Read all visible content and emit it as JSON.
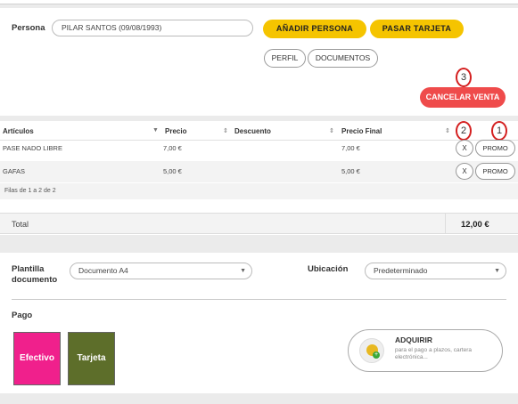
{
  "persona": {
    "label": "Persona",
    "value": "PILAR SANTOS (09/08/1993)",
    "add_button": "AÑADIR PERSONA",
    "card_button": "PASAR TARJETA",
    "profile_button": "PERFIL",
    "documents_button": "DOCUMENTOS"
  },
  "cancel_button": "CANCELAR VENTA",
  "markers": [
    "3",
    "2",
    "1"
  ],
  "table": {
    "columns": [
      "Artículos",
      "Precio",
      "Descuento",
      "Precio Final"
    ],
    "rows": [
      {
        "articulo": "PASE NADO LIBRE",
        "precio": "7,00 €",
        "descuento": "",
        "precio_final": "7,00 €",
        "remove": "X",
        "promo": "PROMO"
      },
      {
        "articulo": "GAFAS",
        "precio": "5,00 €",
        "descuento": "",
        "precio_final": "5,00 €",
        "remove": "X",
        "promo": "PROMO"
      }
    ],
    "pager": "Filas de 1 a 2 de 2"
  },
  "total": {
    "label": "Total",
    "value": "12,00 €"
  },
  "document": {
    "template_label": "Plantilla documento",
    "template_value": "Documento A4",
    "location_label": "Ubicación",
    "location_value": "Predeterminado"
  },
  "payment": {
    "label": "Pago",
    "methods": [
      {
        "label": "Efectivo",
        "color": "#f0208c"
      },
      {
        "label": "Tarjeta",
        "color": "#5d6e2a"
      }
    ],
    "acquire": {
      "title": "ADQUIRIR",
      "description": "para el pago a plazos, cartera electrónica..."
    }
  }
}
